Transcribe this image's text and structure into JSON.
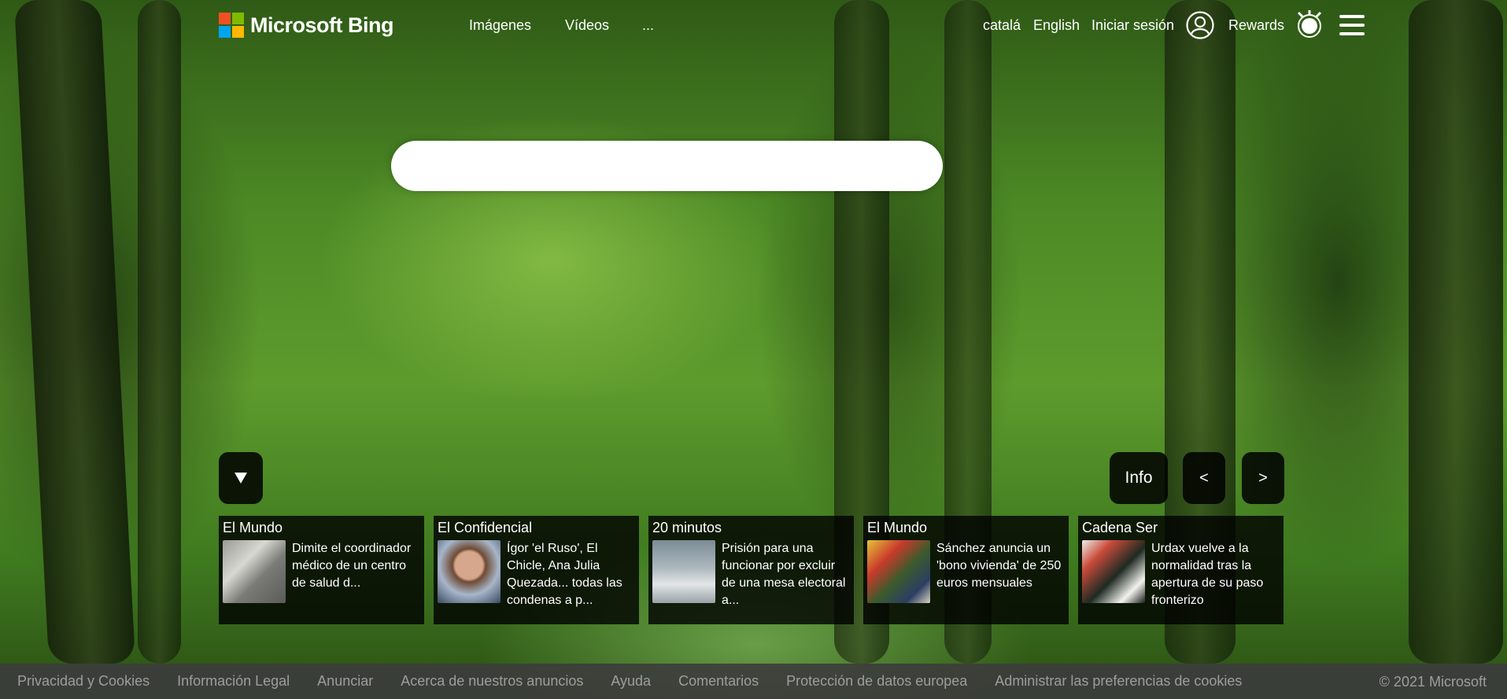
{
  "header": {
    "logo_text": "Microsoft Bing",
    "nav": [
      "Imágenes",
      "Vídeos",
      "..."
    ],
    "languages": [
      "catalá",
      "English"
    ],
    "sign_in": "Iniciar sesión",
    "rewards": "Rewards"
  },
  "search": {
    "placeholder": "",
    "value": ""
  },
  "controls": {
    "info": "Info",
    "prev": "<",
    "next": ">"
  },
  "news": [
    {
      "source": "El Mundo",
      "title": "Dimite el coordinador médico de un centro de salud d..."
    },
    {
      "source": "El Confidencial",
      "title": "Ígor 'el Ruso', El Chicle, Ana Julia Quezada... todas las condenas a p..."
    },
    {
      "source": "20 minutos",
      "title": "Prisión para una funcionar por excluir de una mesa electoral a..."
    },
    {
      "source": "El Mundo",
      "title": "Sánchez anuncia un 'bono vivienda' de 250 euros mensuales"
    },
    {
      "source": "Cadena Ser",
      "title": "Urdax vuelve a la normalidad tras la apertura de su paso fronterizo"
    }
  ],
  "footer": {
    "links": [
      "Privacidad y Cookies",
      "Información Legal",
      "Anunciar",
      "Acerca de nuestros anuncios",
      "Ayuda",
      "Comentarios",
      "Protección de datos europea",
      "Administrar las preferencias de cookies"
    ],
    "copyright": "© 2021 Microsoft"
  },
  "icons": [
    "microsoft-logo-icon",
    "avatar-icon",
    "rewards-medal-icon",
    "hamburger-menu-icon",
    "chevron-down-icon"
  ]
}
